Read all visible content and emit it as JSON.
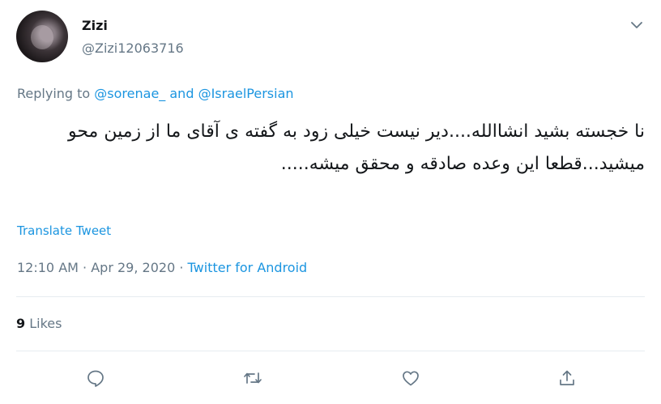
{
  "author": {
    "name": "Zizi",
    "handle": "@Zizi12063716"
  },
  "replying": {
    "prefix": "Replying to",
    "user1": "@sorenae_",
    "conjunction": "and",
    "user2": "@IsraelPersian"
  },
  "tweet": {
    "text": "نا خجسته بشید انشاالله....دیر نیست خیلی زود به گفته ی آقای ما از زمین محو میشید...قطعا این وعده صادقه و محقق میشه....."
  },
  "translate_label": "Translate Tweet",
  "meta": {
    "time": "12:10 AM",
    "dot1": "·",
    "date": "Apr 29, 2020",
    "dot2": "·",
    "source": "Twitter for Android"
  },
  "stats": {
    "likes_count": "9",
    "likes_label": "Likes"
  },
  "icons": {
    "menu": "chevron-down-icon",
    "reply": "reply-icon",
    "retweet": "retweet-icon",
    "like": "heart-icon",
    "share": "share-icon"
  },
  "colors": {
    "link": "#1b95e0",
    "muted": "#657786",
    "text": "#14171a",
    "divider": "#e6ecf0"
  }
}
